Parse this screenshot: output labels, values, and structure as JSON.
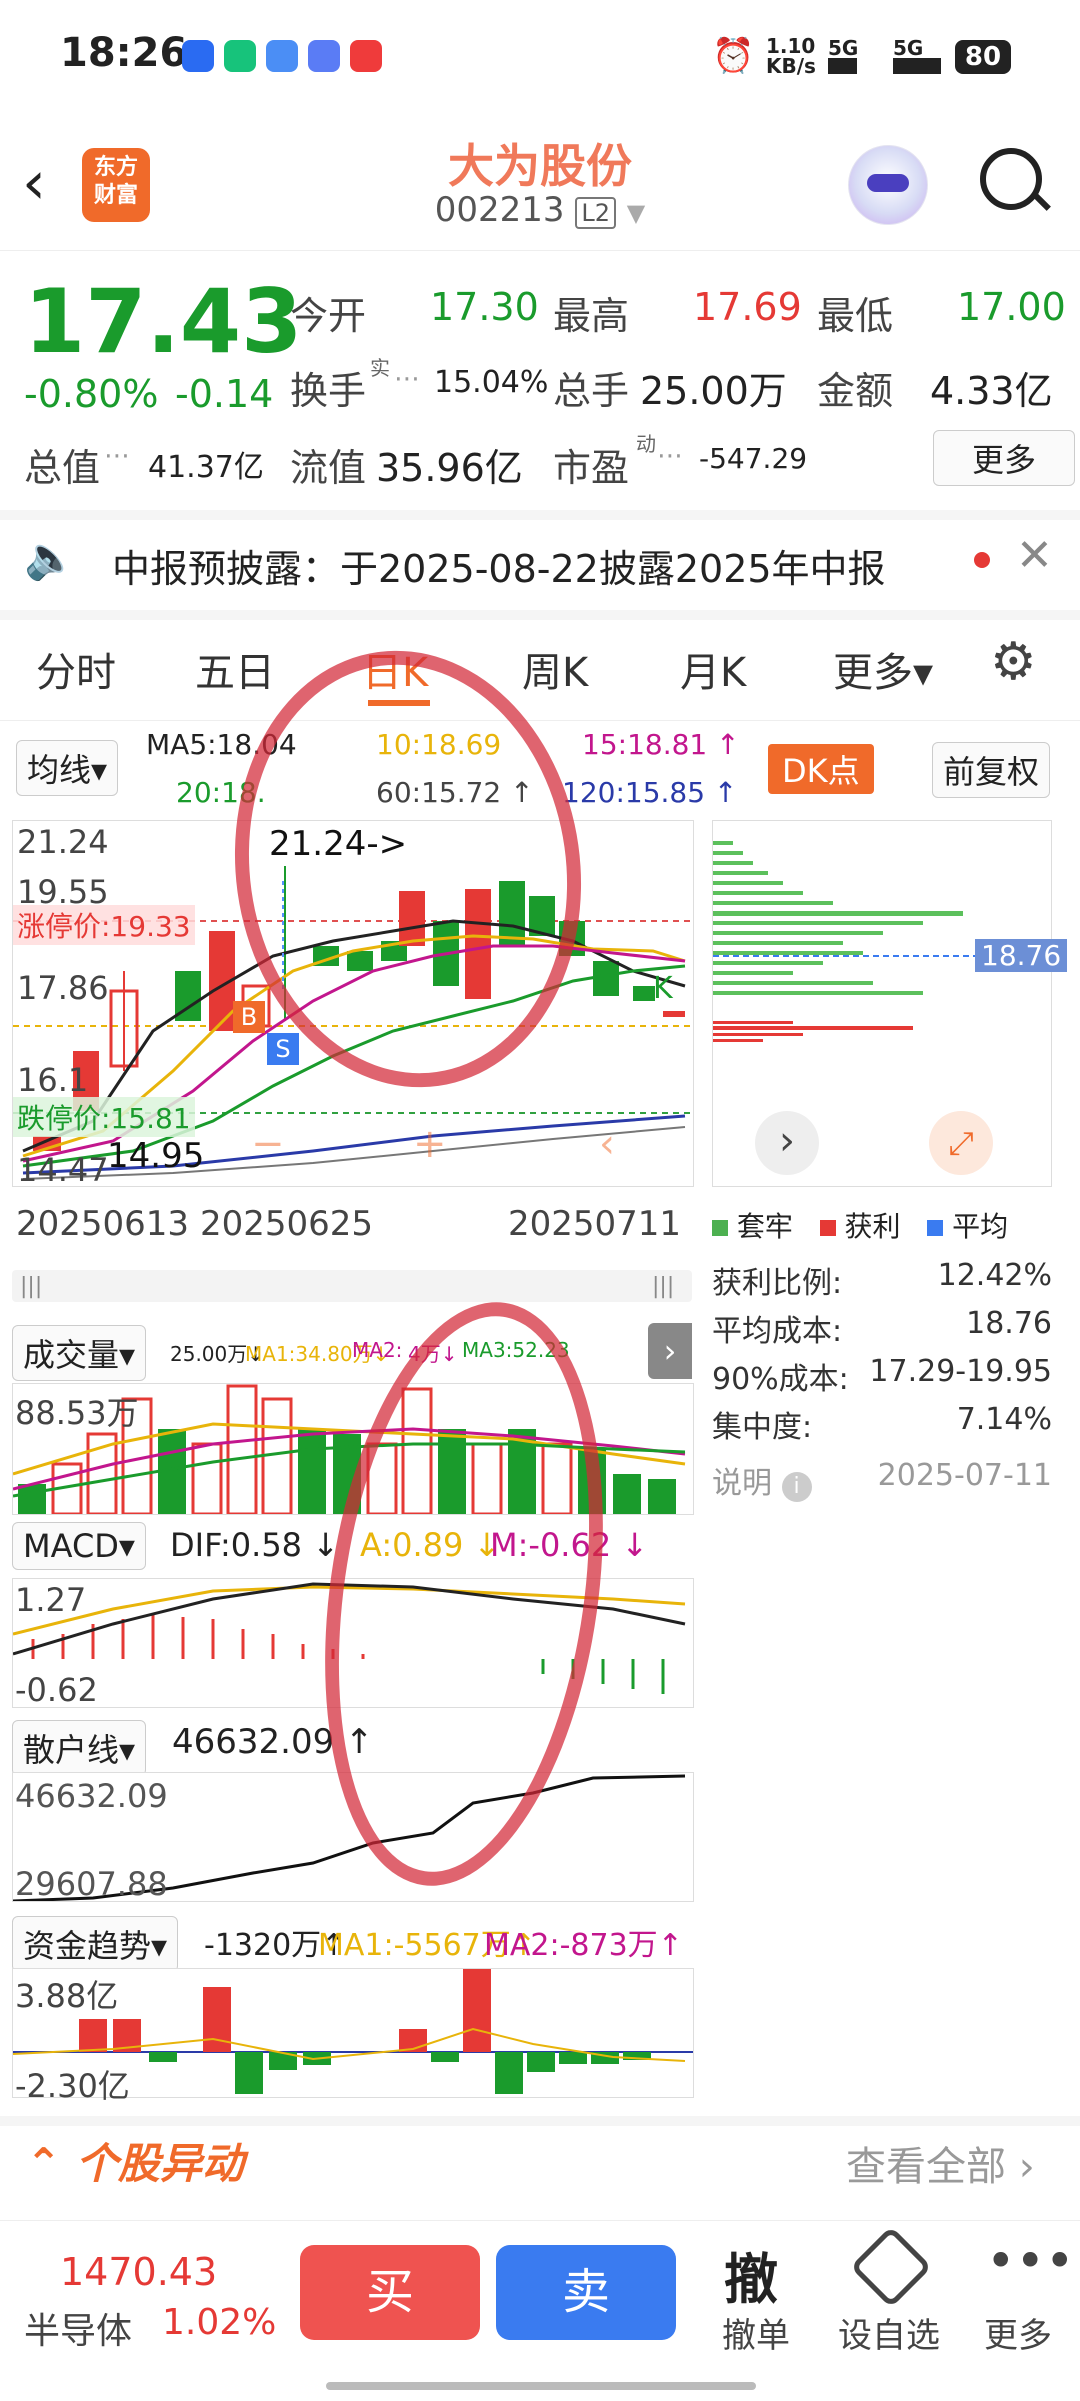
{
  "status_bar": {
    "time": "18:26",
    "net_speed": "1.10",
    "net_unit": "KB/s",
    "sig1": "5G",
    "sig2": "5G",
    "battery": "80"
  },
  "header": {
    "logo_text": "东方\n财富",
    "title": "大为股份",
    "code": "002213",
    "l2": "L2"
  },
  "quote": {
    "price": "17.43",
    "change_pct": "-0.80%",
    "change": "-0.14",
    "open_label": "今开",
    "open": "17.30",
    "high_label": "最高",
    "high": "17.69",
    "low_label": "最低",
    "low": "17.00",
    "turnover_label": "换手",
    "turnover_sup": "实",
    "turnover": "15.04%",
    "volume_label": "总手",
    "volume": "25.00万",
    "amount_label": "金额",
    "amount": "4.33亿",
    "mcap_label": "总值",
    "mcap": "41.37亿",
    "float_label": "流值",
    "float": "35.96亿",
    "pe_label": "市盈",
    "pe_sup": "动",
    "pe": "-547.29",
    "more_label": "更多"
  },
  "notice": {
    "text": "中报预披露：于2025-08-22披露2025年中报"
  },
  "tabs": [
    "分时",
    "五日",
    "日K",
    "周K",
    "月K",
    "更多▾"
  ],
  "kline": {
    "ma_select": "均线▾",
    "ma5": "MA5:18.04",
    "ma10": "10:18.69",
    "ma15": "15:18.81 ↑",
    "ma20": "20:18.",
    "ma60": "60:15.72 ↑",
    "ma120": "120:15.85 ↑",
    "dk_label": "DK点",
    "fq_label": "前复权",
    "y_labels": [
      "21.24",
      "19.55",
      "17.86",
      "16.1",
      "14.47"
    ],
    "limit_up": "涨停价:19.33",
    "limit_down": "跌停价:15.81",
    "high_mark": "21.24->",
    "low_mark": "14.95",
    "dates": [
      "20250613",
      "20250625",
      "20250711"
    ],
    "profile_price": "18.76"
  },
  "chip_stats": {
    "legend": [
      "套牢",
      "获利",
      "平均"
    ],
    "rows": [
      {
        "k": "获利比例:",
        "v": "12.42%"
      },
      {
        "k": "平均成本:",
        "v": "18.76"
      },
      {
        "k": "90%成本:",
        "v": "17.29-19.95"
      },
      {
        "k": "集中度:",
        "v": "7.14%"
      }
    ],
    "note_label": "说明",
    "note_date": "2025-07-11"
  },
  "volume": {
    "select": "成交量▾",
    "v": "25.00万↓",
    "ma1": "MA1:34.80万↓",
    "ma2": "MA2:",
    "ma2b": "4万↓",
    "ma3": "MA3:52.23",
    "y_label": "88.53万"
  },
  "macd": {
    "select": "MACD▾",
    "dif": "DIF:0.58 ↓",
    "dea": "A:0.89 ↓",
    "m": "M:-0.62 ↓",
    "y_top": "1.27",
    "y_bottom": "-0.62"
  },
  "retail": {
    "select": "散户线▾",
    "value": "46632.09 ↑",
    "y_top": "46632.09",
    "y_bottom": "29607.88"
  },
  "fund": {
    "select": "资金趋势▾",
    "value": "-1320万↑",
    "ma1": "MA1:-5567万↑",
    "ma2": "MA2:-873万↑",
    "y_top": "3.88亿",
    "y_bottom": "-2.30亿"
  },
  "movement": {
    "title": "个股异动",
    "view_all": "查看全部"
  },
  "bottom_bar": {
    "index_value": "1470.43",
    "index_name": "半导体",
    "index_change": "1.02%",
    "buy": "买",
    "sell": "卖",
    "cancel_big": "撤",
    "cancel": "撤单",
    "watch": "设自选",
    "more": "更多"
  },
  "colors": {
    "up": "#e53935",
    "down": "#1a9b2c",
    "accent": "#f06a2a",
    "sell": "#3a7bf0",
    "buy": "#ef5350",
    "annotation": "#d22837"
  }
}
